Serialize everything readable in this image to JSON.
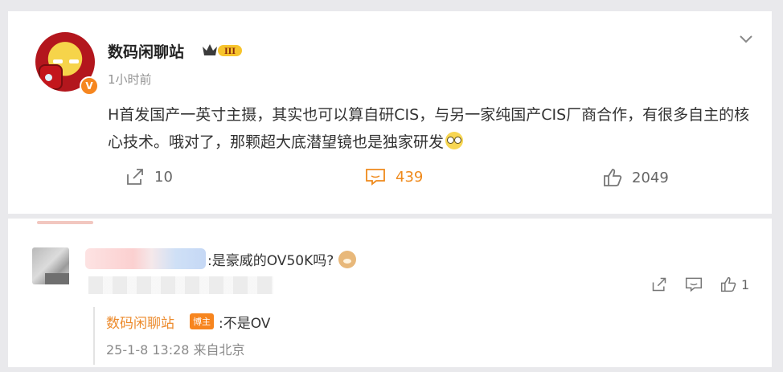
{
  "post": {
    "username": "数码闲聊站",
    "level_badge": "III",
    "verified_badge": "V",
    "time": "1小时前",
    "content": "H首发国产一英寸主摄，其实也可以算自研CIS，与另一家纯国产CIS厂商合作，有很多自主的核心技术。哦对了，那颗超大底潜望镜也是独家研发",
    "actions": {
      "forward_count": "10",
      "comment_count": "439",
      "like_count": "2049"
    },
    "colors": {
      "accent": "#ef8a1c",
      "text": "#333333",
      "muted": "#939393"
    }
  },
  "comment": {
    "text": ":是豪威的OV50K吗?",
    "like_count": "1",
    "reply": {
      "name": "数码闲聊站",
      "badge": "博主",
      "text": ":不是OV",
      "meta": "25-1-8 13:28 来自北京"
    }
  },
  "icons": [
    "chevron-down-icon",
    "forward-icon",
    "comment-icon",
    "like-icon",
    "crown-icon",
    "verified-icon"
  ]
}
